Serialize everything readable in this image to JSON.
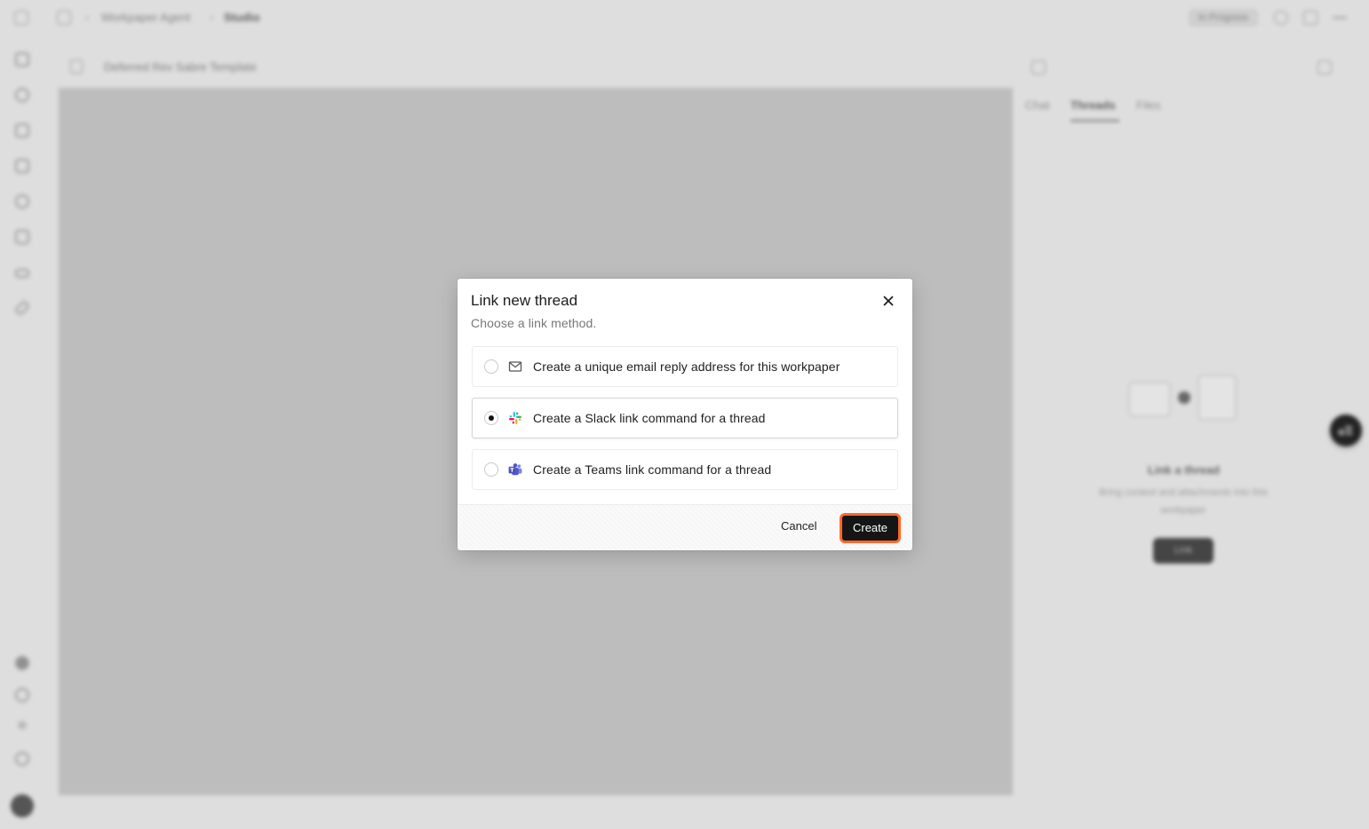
{
  "app": {
    "breadcrumb": [
      "Workpaper Agent",
      "Studio"
    ],
    "status_pill": "In Progress",
    "document_title": "Deferred Rev Sabre Template"
  },
  "right_panel": {
    "tabs": [
      "Chat",
      "Threads",
      "Files"
    ],
    "active_tab": "Threads",
    "empty_heading": "Link a thread",
    "empty_sub": "Bring context and attachments into this workpaper",
    "link_button": "Link"
  },
  "dialog": {
    "title": "Link new thread",
    "subtitle": "Choose a link method.",
    "options": [
      {
        "label": "Create a unique email reply address for this workpaper",
        "icon": "mail-icon",
        "selected": false
      },
      {
        "label": "Create a Slack link command for a thread",
        "icon": "slack-icon",
        "selected": true
      },
      {
        "label": "Create a Teams link command for a thread",
        "icon": "teams-icon",
        "selected": false
      }
    ],
    "cancel_label": "Cancel",
    "create_label": "Create",
    "accent_color": "#ff6a2b"
  }
}
